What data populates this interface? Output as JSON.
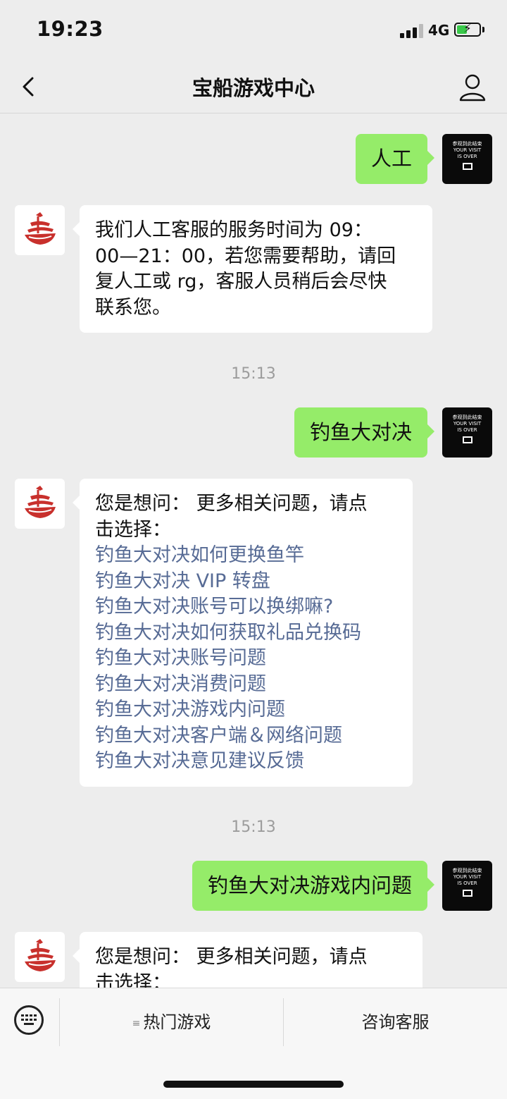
{
  "status_bar": {
    "time": "19:23",
    "network": "4G"
  },
  "nav": {
    "title": "宝船游戏中心"
  },
  "user_avatar": {
    "line1": "参观到此结束",
    "line2": "YOUR VISIT",
    "line3": "IS OVER"
  },
  "messages": {
    "m1": {
      "text": "人工"
    },
    "m2": {
      "lines": [
        "我们人工客服的服务时间为 09：",
        "00—21：00，若您需要帮助，请回",
        "复人工或 rg，客服人员稍后会尽快",
        "联系您。"
      ]
    },
    "ts1": "15:13",
    "m3": {
      "text": "钓鱼大对决"
    },
    "m4": {
      "intro1": "您是想问： 更多相关问题，请点",
      "intro2": "击选择：",
      "links": [
        "钓鱼大对决如何更换鱼竿",
        "钓鱼大对决 VIP 转盘",
        "钓鱼大对决账号可以换绑嘛?",
        "钓鱼大对决如何获取礼品兑换码",
        "钓鱼大对决账号问题",
        "钓鱼大对决消费问题",
        "钓鱼大对决游戏内问题",
        "钓鱼大对决客户端＆网络问题",
        "钓鱼大对决意见建议反馈"
      ]
    },
    "ts2": "15:13",
    "m5": {
      "text": "钓鱼大对决游戏内问题"
    },
    "m6": {
      "intro1": "您是想问： 更多相关问题，请点",
      "intro2": "击选择："
    }
  },
  "bottom_menu": {
    "item1": "热门游戏",
    "item1_icon": "≡",
    "item2": "咨询客服"
  },
  "colors": {
    "user_bubble": "#95ec69",
    "link": "#576b95",
    "background": "#ededed",
    "bot_logo": "#c8302c"
  }
}
